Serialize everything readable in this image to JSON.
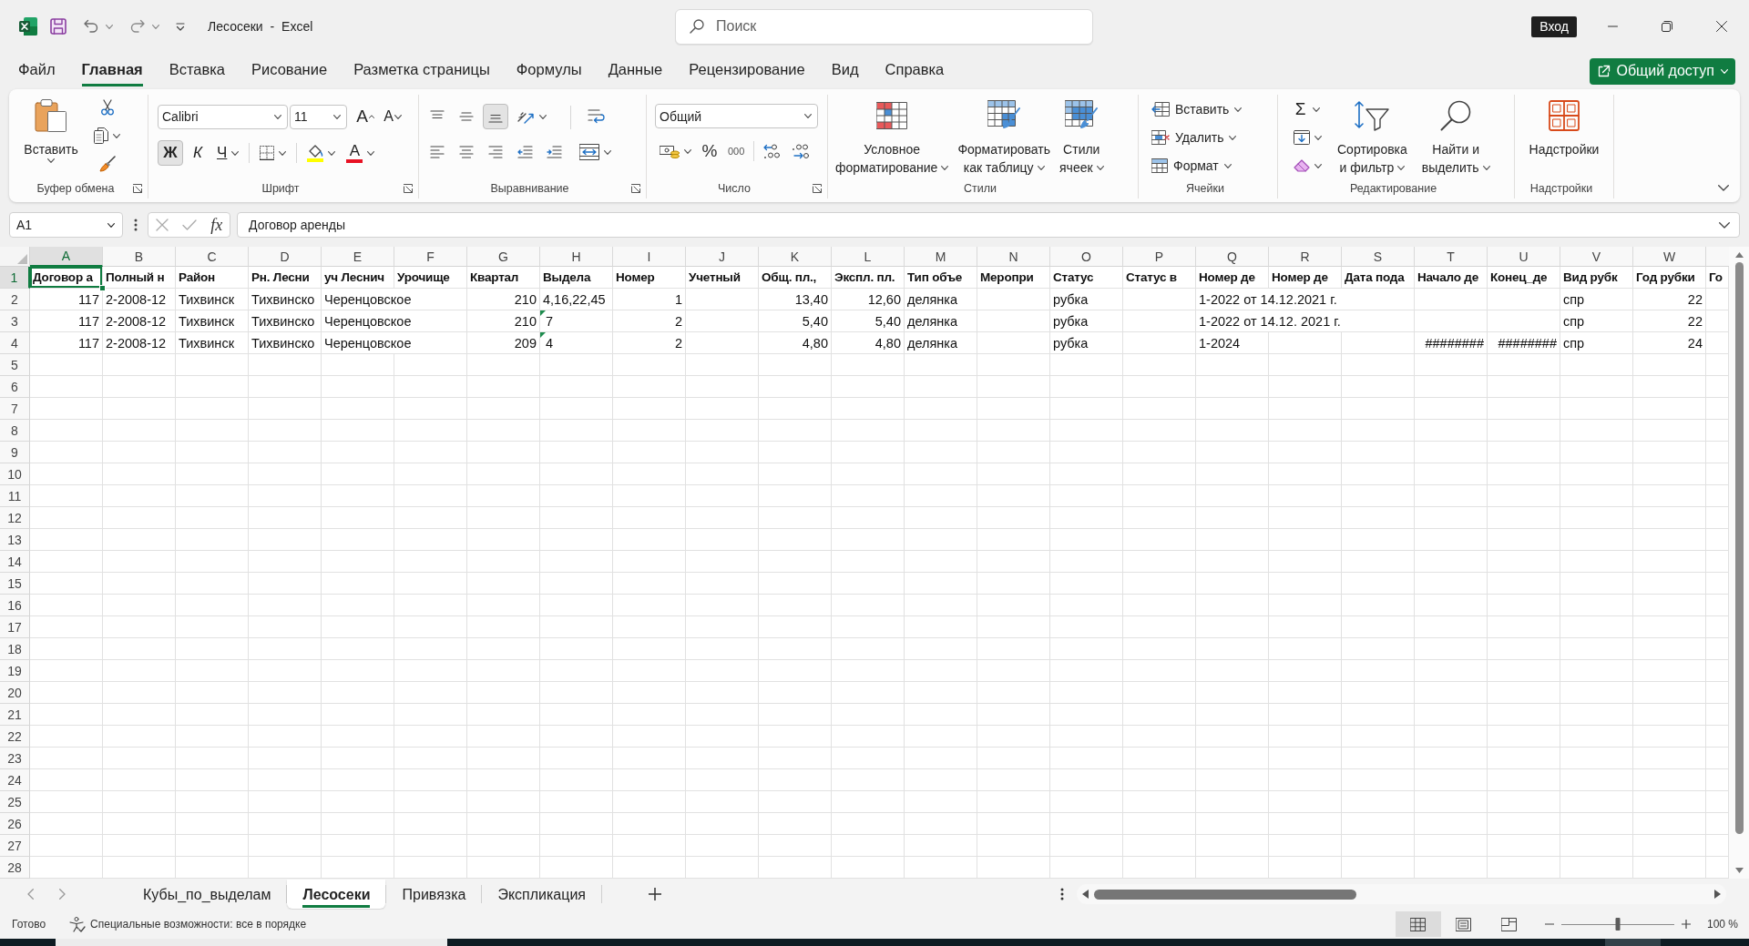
{
  "window": {
    "title": "Лесосеки - Excel",
    "search_placeholder": "Поиск",
    "sign_in": "Вход"
  },
  "menu_tabs": [
    {
      "label": "Файл",
      "selected": false
    },
    {
      "label": "Главная",
      "selected": true
    },
    {
      "label": "Вставка",
      "selected": false
    },
    {
      "label": "Рисование",
      "selected": false
    },
    {
      "label": "Разметка страницы",
      "selected": false
    },
    {
      "label": "Формулы",
      "selected": false
    },
    {
      "label": "Данные",
      "selected": false
    },
    {
      "label": "Рецензирование",
      "selected": false
    },
    {
      "label": "Вид",
      "selected": false
    },
    {
      "label": "Справка",
      "selected": false
    }
  ],
  "share_button": "Общий доступ",
  "ribbon": {
    "clipboard": {
      "label": "Буфер обмена",
      "paste": "Вставить"
    },
    "font": {
      "label": "Шрифт",
      "font_name": "Calibri",
      "font_size": "11",
      "grow": "A",
      "shrink": "A",
      "styles": [
        {
          "kind": "bold",
          "label": "Ж",
          "selected": true
        },
        {
          "kind": "italic",
          "label": "К",
          "selected": false
        },
        {
          "kind": "underline",
          "label": "Ч",
          "selected": false
        }
      ],
      "font_color": "A"
    },
    "alignment": {
      "label": "Выравнивание",
      "vertical": [
        {
          "kind": "top",
          "selected": false
        },
        {
          "kind": "middle",
          "selected": false
        },
        {
          "kind": "bottom",
          "selected": true
        }
      ],
      "horizontal": [
        {
          "kind": "left",
          "selected": false
        },
        {
          "kind": "center",
          "selected": false
        },
        {
          "kind": "right",
          "selected": false
        }
      ]
    },
    "number": {
      "label": "Число",
      "format": "Общий",
      "percent": "%",
      "thousands": "000"
    },
    "styles": {
      "label": "Стили",
      "buttons": [
        {
          "kind": "conditional",
          "lines": [
            "Условное",
            "форматирование"
          ]
        },
        {
          "kind": "table",
          "lines": [
            "Форматировать",
            "как таблицу"
          ]
        },
        {
          "kind": "cell_styles",
          "lines": [
            "Стили",
            "ячеек"
          ]
        }
      ]
    },
    "cells": {
      "label": "Ячейки",
      "buttons": [
        {
          "kind": "insert",
          "label": "Вставить"
        },
        {
          "kind": "delete",
          "label": "Удалить"
        },
        {
          "kind": "format",
          "label": "Формат"
        }
      ]
    },
    "editing": {
      "label": "Редактирование",
      "autosum": "Σ",
      "buttons": [
        {
          "kind": "sort",
          "lines": [
            "Сортировка",
            "и фильтр"
          ]
        },
        {
          "kind": "find",
          "lines": [
            "Найти и",
            "выделить"
          ]
        }
      ]
    },
    "addins": {
      "label": "Надстройки",
      "button": "Надстройки"
    }
  },
  "formula_bar": {
    "name_box": "A1",
    "function_label": "fx",
    "formula": "Договор аренды"
  },
  "sheet": {
    "columns": [
      {
        "label": "A",
        "selected": true
      },
      {
        "label": "B",
        "selected": false
      },
      {
        "label": "C",
        "selected": false
      },
      {
        "label": "D",
        "selected": false
      },
      {
        "label": "E",
        "selected": false
      },
      {
        "label": "F",
        "selected": false
      },
      {
        "label": "G",
        "selected": false
      },
      {
        "label": "H",
        "selected": false
      },
      {
        "label": "I",
        "selected": false
      },
      {
        "label": "J",
        "selected": false
      },
      {
        "label": "K",
        "selected": false
      },
      {
        "label": "L",
        "selected": false
      },
      {
        "label": "M",
        "selected": false
      },
      {
        "label": "N",
        "selected": false
      },
      {
        "label": "O",
        "selected": false
      },
      {
        "label": "P",
        "selected": false
      },
      {
        "label": "Q",
        "selected": false
      },
      {
        "label": "R",
        "selected": false
      },
      {
        "label": "S",
        "selected": false
      },
      {
        "label": "T",
        "selected": false
      },
      {
        "label": "U",
        "selected": false
      },
      {
        "label": "V",
        "selected": false
      },
      {
        "label": "W",
        "selected": false
      }
    ],
    "rows": [
      {
        "header": "1",
        "selected": true,
        "cells": [
          {
            "kind": "heading",
            "text": "Договор а"
          },
          {
            "kind": "heading",
            "text": "Полный н"
          },
          {
            "kind": "heading",
            "text": "Район"
          },
          {
            "kind": "heading",
            "text": "Рн. Лесни"
          },
          {
            "kind": "heading",
            "text": "уч Леснич"
          },
          {
            "kind": "heading",
            "text": "Урочище"
          },
          {
            "kind": "heading",
            "text": "Квартал"
          },
          {
            "kind": "heading",
            "text": "Выдела"
          },
          {
            "kind": "heading",
            "text": "Номер"
          },
          {
            "kind": "heading",
            "text": "Учетный"
          },
          {
            "kind": "heading",
            "text": "Общ. пл.,"
          },
          {
            "kind": "heading",
            "text": "Экспл. пл."
          },
          {
            "kind": "heading",
            "text": "Тип объе"
          },
          {
            "kind": "heading",
            "text": "Меропри"
          },
          {
            "kind": "heading",
            "text": "Статус"
          },
          {
            "kind": "heading",
            "text": "Статус в"
          },
          {
            "kind": "heading",
            "text": "Номер де"
          },
          {
            "kind": "heading",
            "text": "Номер де"
          },
          {
            "kind": "heading",
            "text": "Дата пода"
          },
          {
            "kind": "heading",
            "text": "Начало де"
          },
          {
            "kind": "heading",
            "text": "Конец_де"
          },
          {
            "kind": "heading",
            "text": "Вид рубк"
          },
          {
            "kind": "heading",
            "text": "Год рубки"
          },
          {
            "kind": "heading",
            "text": "Го"
          }
        ]
      },
      {
        "header": "2",
        "selected": false,
        "cells": [
          {
            "kind": "number",
            "text": "117"
          },
          {
            "kind": "text",
            "text": "2-2008-12"
          },
          {
            "kind": "text",
            "text": "Тихвинск"
          },
          {
            "kind": "text",
            "text": "Тихвинско"
          },
          {
            "kind": "text",
            "text": "Черенцовское"
          },
          {
            "kind": "empty"
          },
          {
            "kind": "number",
            "text": "210"
          },
          {
            "kind": "text",
            "text": "4,16,22,45"
          },
          {
            "kind": "number",
            "text": "1"
          },
          {
            "kind": "empty"
          },
          {
            "kind": "number",
            "text": "13,40"
          },
          {
            "kind": "number",
            "text": "12,60"
          },
          {
            "kind": "text",
            "text": "делянка"
          },
          {
            "kind": "empty"
          },
          {
            "kind": "text",
            "text": "рубка"
          },
          {
            "kind": "empty"
          },
          {
            "kind": "text",
            "text": "1-2022 от 14.12.2021 г."
          },
          {
            "kind": "empty"
          },
          {
            "kind": "empty"
          },
          {
            "kind": "empty"
          },
          {
            "kind": "empty"
          },
          {
            "kind": "text",
            "text": "спр"
          },
          {
            "kind": "number",
            "text": "22"
          },
          {
            "kind": "empty"
          }
        ]
      },
      {
        "header": "3",
        "selected": false,
        "cells": [
          {
            "kind": "number",
            "text": "117"
          },
          {
            "kind": "text",
            "text": "2-2008-12"
          },
          {
            "kind": "text",
            "text": "Тихвинск"
          },
          {
            "kind": "text",
            "text": "Тихвинско"
          },
          {
            "kind": "text",
            "text": "Черенцовское"
          },
          {
            "kind": "empty"
          },
          {
            "kind": "number",
            "text": "210"
          },
          {
            "kind": "number_as_text",
            "text": "7"
          },
          {
            "kind": "number",
            "text": "2"
          },
          {
            "kind": "empty"
          },
          {
            "kind": "number",
            "text": "5,40"
          },
          {
            "kind": "number",
            "text": "5,40"
          },
          {
            "kind": "text",
            "text": "делянка"
          },
          {
            "kind": "empty"
          },
          {
            "kind": "text",
            "text": "рубка"
          },
          {
            "kind": "empty"
          },
          {
            "kind": "text",
            "text": "1-2022 от 14.12. 2021 г."
          },
          {
            "kind": "empty"
          },
          {
            "kind": "empty"
          },
          {
            "kind": "empty"
          },
          {
            "kind": "empty"
          },
          {
            "kind": "text",
            "text": "спр"
          },
          {
            "kind": "number",
            "text": "22"
          },
          {
            "kind": "empty"
          }
        ]
      },
      {
        "header": "4",
        "selected": false,
        "cells": [
          {
            "kind": "number",
            "text": "117"
          },
          {
            "kind": "text",
            "text": "2-2008-12"
          },
          {
            "kind": "text",
            "text": "Тихвинск"
          },
          {
            "kind": "text",
            "text": "Тихвинско"
          },
          {
            "kind": "text",
            "text": "Черенцовское"
          },
          {
            "kind": "empty"
          },
          {
            "kind": "number",
            "text": "209"
          },
          {
            "kind": "number_as_text",
            "text": "4"
          },
          {
            "kind": "number",
            "text": "2"
          },
          {
            "kind": "empty"
          },
          {
            "kind": "number",
            "text": "4,80"
          },
          {
            "kind": "number",
            "text": "4,80"
          },
          {
            "kind": "text",
            "text": "делянка"
          },
          {
            "kind": "empty"
          },
          {
            "kind": "text",
            "text": "рубка"
          },
          {
            "kind": "empty"
          },
          {
            "kind": "text",
            "text": "1-2024"
          },
          {
            "kind": "empty"
          },
          {
            "kind": "empty"
          },
          {
            "kind": "number",
            "text": "########"
          },
          {
            "kind": "number",
            "text": "########"
          },
          {
            "kind": "text",
            "text": "спр"
          },
          {
            "kind": "number",
            "text": "24"
          },
          {
            "kind": "empty"
          }
        ]
      },
      {
        "header": "5",
        "selected": false
      },
      {
        "header": "6",
        "selected": false
      },
      {
        "header": "7",
        "selected": false
      },
      {
        "header": "8",
        "selected": false
      },
      {
        "header": "9",
        "selected": false
      },
      {
        "header": "10",
        "selected": false
      },
      {
        "header": "11",
        "selected": false
      },
      {
        "header": "12",
        "selected": false
      },
      {
        "header": "13",
        "selected": false
      },
      {
        "header": "14",
        "selected": false
      },
      {
        "header": "15",
        "selected": false
      },
      {
        "header": "16",
        "selected": false
      },
      {
        "header": "17",
        "selected": false
      },
      {
        "header": "18",
        "selected": false
      },
      {
        "header": "19",
        "selected": false
      },
      {
        "header": "20",
        "selected": false
      },
      {
        "header": "21",
        "selected": false
      },
      {
        "header": "22",
        "selected": false
      },
      {
        "header": "23",
        "selected": false
      },
      {
        "header": "24",
        "selected": false
      },
      {
        "header": "25",
        "selected": false
      },
      {
        "header": "26",
        "selected": false
      },
      {
        "header": "27",
        "selected": false
      },
      {
        "header": "28",
        "selected": false
      }
    ]
  },
  "sheet_tabs": [
    {
      "label": "Кубы_по_выделам",
      "selected": false
    },
    {
      "label": "Лесосеки",
      "selected": true
    },
    {
      "label": "Привязка",
      "selected": false
    },
    {
      "label": "Экспликация",
      "selected": false
    }
  ],
  "status_bar": {
    "ready": "Готово",
    "accessibility": "Специальные возможности: все в порядке",
    "views": [
      {
        "kind": "normal",
        "selected": true
      },
      {
        "kind": "page_layout",
        "selected": false
      },
      {
        "kind": "page_break",
        "selected": false
      }
    ],
    "zoom": {
      "label": "100 %",
      "level": 0.5
    }
  }
}
